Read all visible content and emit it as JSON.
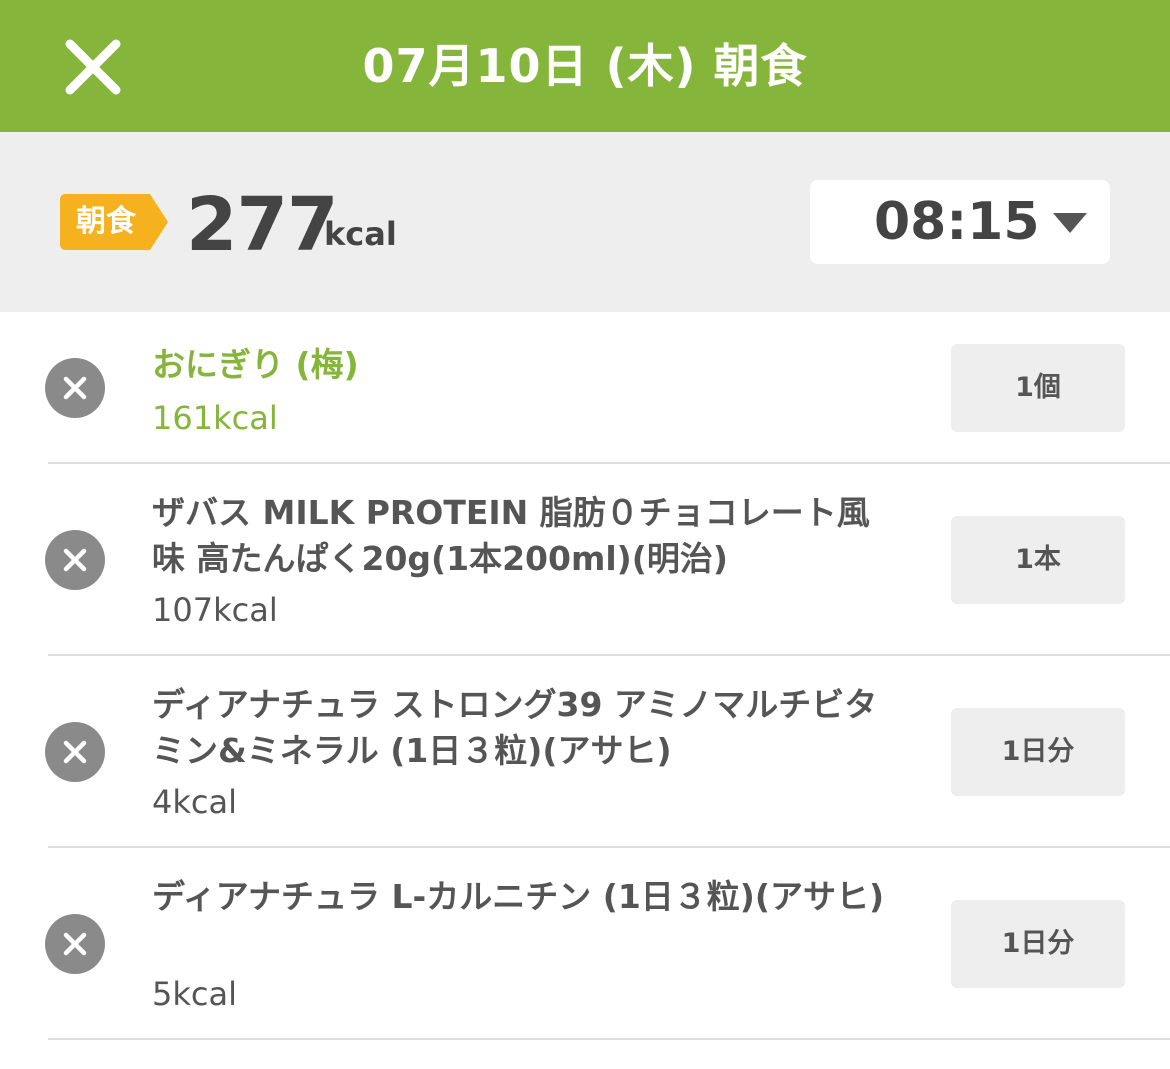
{
  "header": {
    "title": "07月10日 (木) 朝食",
    "close_icon": "close-icon"
  },
  "summary": {
    "meal_tag": "朝食",
    "total_kcal": "277",
    "kcal_unit": "kcal",
    "time": "08:15",
    "tag_color": "#f5b21e"
  },
  "theme": {
    "accent": "#86b53c"
  },
  "foods": [
    {
      "name": "おにぎり (梅)",
      "kcal": "161kcal",
      "qty": "1個"
    },
    {
      "name": "ザバス MILK PROTEIN 脂肪０チョコレート風味 高たんぱく20g(1本200ml)(明治)",
      "kcal": "107kcal",
      "qty": "1本"
    },
    {
      "name": "ディアナチュラ ストロング39 アミノマルチビタミン&ミネラル (1日３粒)(アサヒ)",
      "kcal": "4kcal",
      "qty": "1日分"
    },
    {
      "name": "ディアナチュラ L-カルニチン (1日３粒)(アサヒ)",
      "kcal": "5kcal",
      "qty": "1日分"
    }
  ]
}
